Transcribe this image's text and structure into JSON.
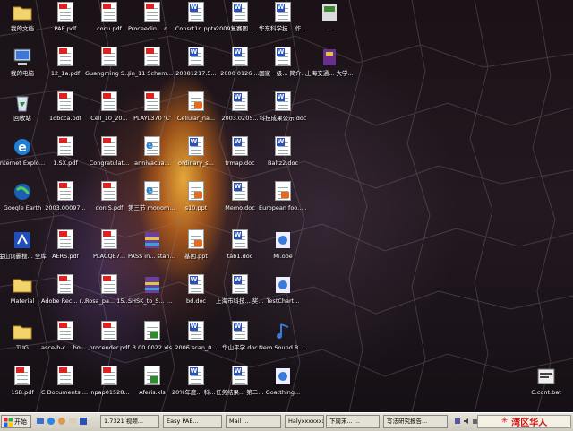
{
  "desktop": {
    "icons": [
      {
        "label": "我的文档",
        "type": "folder"
      },
      {
        "label": "PAE.pdf",
        "type": "pdf"
      },
      {
        "label": "cocu.pdf",
        "type": "pdf"
      },
      {
        "label": "Proceedin... collected ...",
        "type": "pdf"
      },
      {
        "label": "Consrt1n.pptx",
        "type": "doc"
      },
      {
        "label": "2009复赛图... 中文版.doc",
        "type": "word"
      },
      {
        "label": "华东科学技... 作业报告",
        "type": "word"
      },
      {
        "label": "...",
        "type": "app"
      },
      {
        "label": "我的电脑",
        "type": "computer"
      },
      {
        "label": "12_1a.pdf",
        "type": "pdf"
      },
      {
        "label": "Guangming Shell Struc...",
        "type": "pdf"
      },
      {
        "label": "Jin_11 Scheme_...",
        "type": "pdf"
      },
      {
        "label": "20081217.5...",
        "type": "doc"
      },
      {
        "label": "2000 0126 ...",
        "type": "word"
      },
      {
        "label": "国家一级... 简介...",
        "type": "word"
      },
      {
        "label": "上海交通... 大学...",
        "type": "book"
      },
      {
        "label": "回收站",
        "type": "recycle"
      },
      {
        "label": "1dbcca.pdf",
        "type": "pdf"
      },
      {
        "label": "Cell_10_20...",
        "type": "pdf"
      },
      {
        "label": "PLAYL370 'C'",
        "type": "pdf"
      },
      {
        "label": "Cellular_na...",
        "type": "ppt"
      },
      {
        "label": "2003.0205...",
        "type": "word"
      },
      {
        "label": "科技成果公示 doc",
        "type": "word"
      },
      {
        "label": "Internet Explorer",
        "type": "ie"
      },
      {
        "label": "1.SX.pdf",
        "type": "pdf"
      },
      {
        "label": "Congratulat...",
        "type": "pdf"
      },
      {
        "label": "annivacua...",
        "type": "html"
      },
      {
        "label": "ordinary_s...",
        "type": "doc"
      },
      {
        "label": "trmap.doc",
        "type": "word"
      },
      {
        "label": "Baltz2.doc",
        "type": "word"
      },
      {
        "label": "Google Earth",
        "type": "earth"
      },
      {
        "label": "2003.00097...",
        "type": "pdf"
      },
      {
        "label": "donIS.pdf",
        "type": "pdf"
      },
      {
        "label": "第三节 monomer...",
        "type": "html"
      },
      {
        "label": "s10.ppt",
        "type": "ppt"
      },
      {
        "label": "Memo.doc",
        "type": "word"
      },
      {
        "label": "European foo... ture.ppt",
        "type": "ppt"
      },
      {
        "label": "金山词霸搜... 全库",
        "type": "dict"
      },
      {
        "label": "AERS.pdf",
        "type": "pdf"
      },
      {
        "label": "PLACQE7...",
        "type": "pdf"
      },
      {
        "label": "PASS in... standard...",
        "type": "rar"
      },
      {
        "label": "基因.ppt",
        "type": "ppt"
      },
      {
        "label": "tab1.doc",
        "type": "word"
      },
      {
        "label": "Mi.ooe",
        "type": "q"
      },
      {
        "label": "Material",
        "type": "folder"
      },
      {
        "label": "Adobe Rec... reader.pdf",
        "type": "pdf"
      },
      {
        "label": "Rosa_pa... 15.pdf",
        "type": "pdf"
      },
      {
        "label": "SHSK_to_S... material...",
        "type": "rar"
      },
      {
        "label": "bd.doc",
        "type": "word"
      },
      {
        "label": "上海市科技... 奖(综合)...",
        "type": "word"
      },
      {
        "label": "TestChart...",
        "type": "q"
      },
      {
        "label": "TUG",
        "type": "folder"
      },
      {
        "label": "asce-b-c... book.pdf",
        "type": "pdf"
      },
      {
        "label": "procender.pdf",
        "type": "pdf"
      },
      {
        "label": "3.00.0022.xls",
        "type": "xls"
      },
      {
        "label": "2006.scan_0...",
        "type": "word"
      },
      {
        "label": "华山平学.doc",
        "type": "word"
      },
      {
        "label": "Nero Sound Recorder",
        "type": "music"
      },
      {
        "label": "1SB.pdf",
        "type": "pdf"
      },
      {
        "label": "C Documents and Sett...",
        "type": "pdf"
      },
      {
        "label": "Inpap01528...",
        "type": "pdf"
      },
      {
        "label": "Aferis.xls",
        "type": "xls"
      },
      {
        "label": "20%年度... 科技奖...",
        "type": "word"
      },
      {
        "label": "任务结果... 第二版...",
        "type": "word"
      },
      {
        "label": "Goatthing...",
        "type": "q"
      },
      {
        "label": "C.cont.bat",
        "type": "bat"
      }
    ]
  },
  "taskbar": {
    "start_label": "开始",
    "buttons": [
      {
        "label": "1.7321 视频..."
      },
      {
        "label": "Easy PAE..."
      },
      {
        "label": "Mail ..."
      },
      {
        "label": "Halyxxxxxxx..."
      },
      {
        "label": "下周末... ..."
      },
      {
        "label": "写法研究报告..."
      }
    ],
    "ime_label": "湾区华人",
    "colors": {
      "ime_text": "#d21010"
    }
  }
}
